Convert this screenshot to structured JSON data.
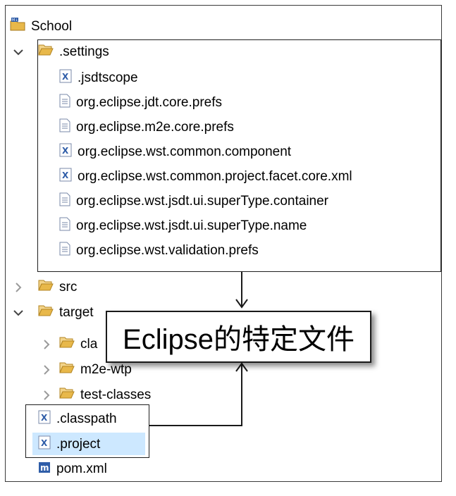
{
  "tree": {
    "root": {
      "label": "School",
      "icon": "maven-project-icon"
    },
    "settings": {
      "label": ".settings",
      "expanded": true
    },
    "settings_files": [
      {
        "label": ".jsdtscope",
        "icon": "xml-file-icon"
      },
      {
        "label": "org.eclipse.jdt.core.prefs",
        "icon": "text-file-icon"
      },
      {
        "label": "org.eclipse.m2e.core.prefs",
        "icon": "text-file-icon"
      },
      {
        "label": "org.eclipse.wst.common.component",
        "icon": "xml-file-icon"
      },
      {
        "label": "org.eclipse.wst.common.project.facet.core.xml",
        "icon": "xml-file-icon"
      },
      {
        "label": "org.eclipse.wst.jsdt.ui.superType.container",
        "icon": "text-file-icon"
      },
      {
        "label": "org.eclipse.wst.jsdt.ui.superType.name",
        "icon": "text-file-icon"
      },
      {
        "label": "org.eclipse.wst.validation.prefs",
        "icon": "text-file-icon"
      }
    ],
    "src": {
      "label": "src",
      "expanded": false
    },
    "target": {
      "label": "target",
      "expanded": true
    },
    "target_children": [
      {
        "label": "cla",
        "expanded": false
      },
      {
        "label": "m2e-wtp",
        "expanded": false
      },
      {
        "label": "test-classes",
        "expanded": false
      }
    ],
    "classpath": {
      "label": ".classpath",
      "icon": "xml-file-icon"
    },
    "project": {
      "label": ".project",
      "icon": "xml-file-icon",
      "selected": true
    },
    "pom": {
      "label": "pom.xml",
      "icon": "maven-pom-icon"
    }
  },
  "annotation": {
    "text": "Eclipse的特定文件"
  },
  "colors": {
    "folder": "#e8b84a",
    "selection": "#cde8ff",
    "xml_icon_blue": "#2f5da8"
  }
}
